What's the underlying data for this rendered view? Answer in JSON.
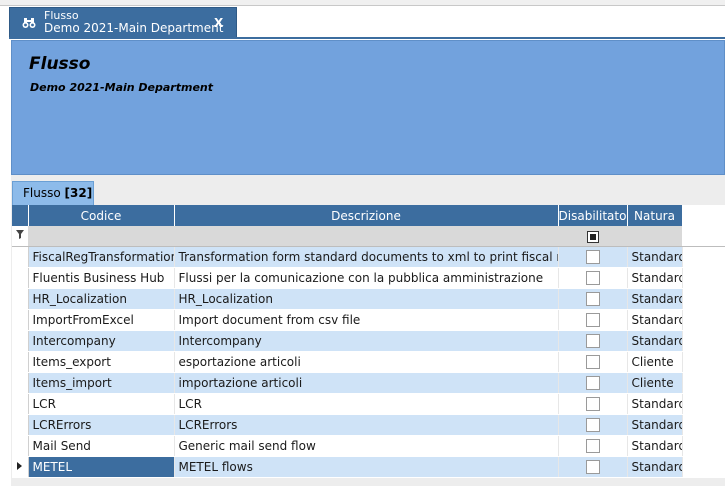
{
  "document_tab": {
    "title": "Flusso",
    "subtitle": "Demo 2021-Main Department",
    "close_label": "X",
    "icon": "binoculars-icon"
  },
  "header": {
    "title": "Flusso",
    "subtitle": "Demo 2021-Main Department"
  },
  "grid_tab": {
    "label": "Flusso",
    "count": "[32]"
  },
  "columns": {
    "codice": "Codice",
    "descrizione": "Descrizione",
    "disabilitato": "Disabilitato",
    "natura": "Natura"
  },
  "filter_row": {
    "icon": "filter-icon",
    "disabilitato_state": "indeterminate"
  },
  "rows": [
    {
      "codice": "FiscalRegTransformations",
      "descrizione": "Transformation form standard documents to xml to print fiscal register",
      "disabilitato": false,
      "natura": "Standard"
    },
    {
      "codice": "Fluentis Business Hub",
      "descrizione": "Flussi per la comunicazione con la pubblica amministrazione",
      "disabilitato": false,
      "natura": "Standard"
    },
    {
      "codice": "HR_Localization",
      "descrizione": "HR_Localization",
      "disabilitato": false,
      "natura": "Standard"
    },
    {
      "codice": "ImportFromExcel",
      "descrizione": "Import document from csv file",
      "disabilitato": false,
      "natura": "Standard"
    },
    {
      "codice": "Intercompany",
      "descrizione": "Intercompany",
      "disabilitato": false,
      "natura": "Standard"
    },
    {
      "codice": "Items_export",
      "descrizione": "esportazione articoli",
      "disabilitato": false,
      "natura": "Cliente"
    },
    {
      "codice": "Items_import",
      "descrizione": "importazione articoli",
      "disabilitato": false,
      "natura": "Cliente"
    },
    {
      "codice": "LCR",
      "descrizione": "LCR",
      "disabilitato": false,
      "natura": "Standard"
    },
    {
      "codice": "LCRErrors",
      "descrizione": "LCRErrors",
      "disabilitato": false,
      "natura": "Standard"
    },
    {
      "codice": "Mail Send",
      "descrizione": "Generic mail send flow",
      "disabilitato": false,
      "natura": "Standard"
    },
    {
      "codice": "METEL",
      "descrizione": "METEL flows",
      "disabilitato": false,
      "natura": "Standard",
      "selected": true
    }
  ],
  "colors": {
    "accent": "#3c6d9f",
    "header_panel": "#72a2dd",
    "row_alt": "#cfe3f7"
  }
}
